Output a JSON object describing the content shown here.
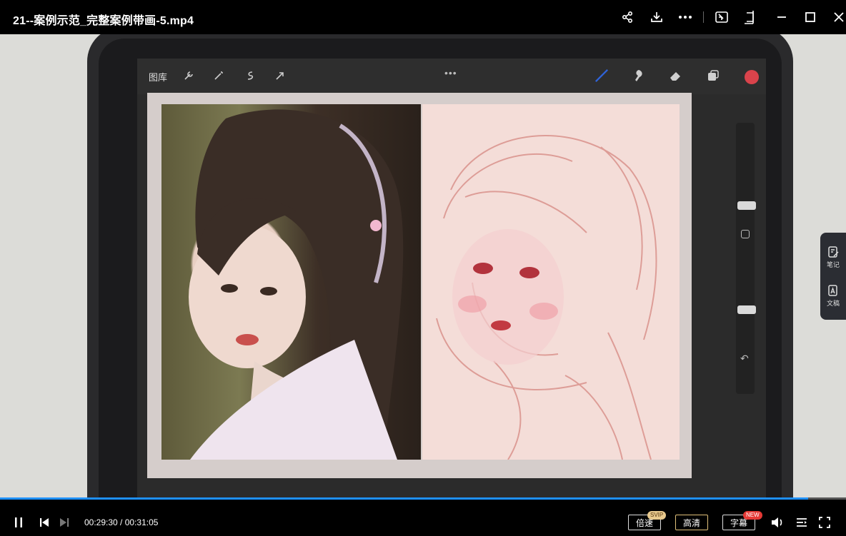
{
  "window": {
    "title": "21--案例示范_完整案例带画-5.mp4",
    "icons": [
      "share-icon",
      "download-icon",
      "more-icon",
      "picture-in-picture-icon",
      "pin-icon",
      "minimize-icon",
      "maximize-icon",
      "close-icon"
    ]
  },
  "procreate": {
    "gallery_label": "图库",
    "tools": [
      "wrench-icon",
      "magic-wand-icon",
      "selection-icon",
      "transform-icon"
    ],
    "right_tools": [
      "brush-icon",
      "smudge-icon",
      "eraser-icon",
      "layers-icon"
    ],
    "color": "#d9434b"
  },
  "side_panel": {
    "notes_label": "笔记",
    "draft_label": "文稿"
  },
  "player": {
    "progress": 0.955,
    "current_time": "00:29:30",
    "separator": " / ",
    "total_time": "00:31:05",
    "speed_label": "倍速",
    "speed_badge": "SVIP",
    "quality_label": "高清",
    "subtitle_label": "字幕",
    "subtitle_badge": "NEW",
    "accent": "#1e90ff"
  }
}
